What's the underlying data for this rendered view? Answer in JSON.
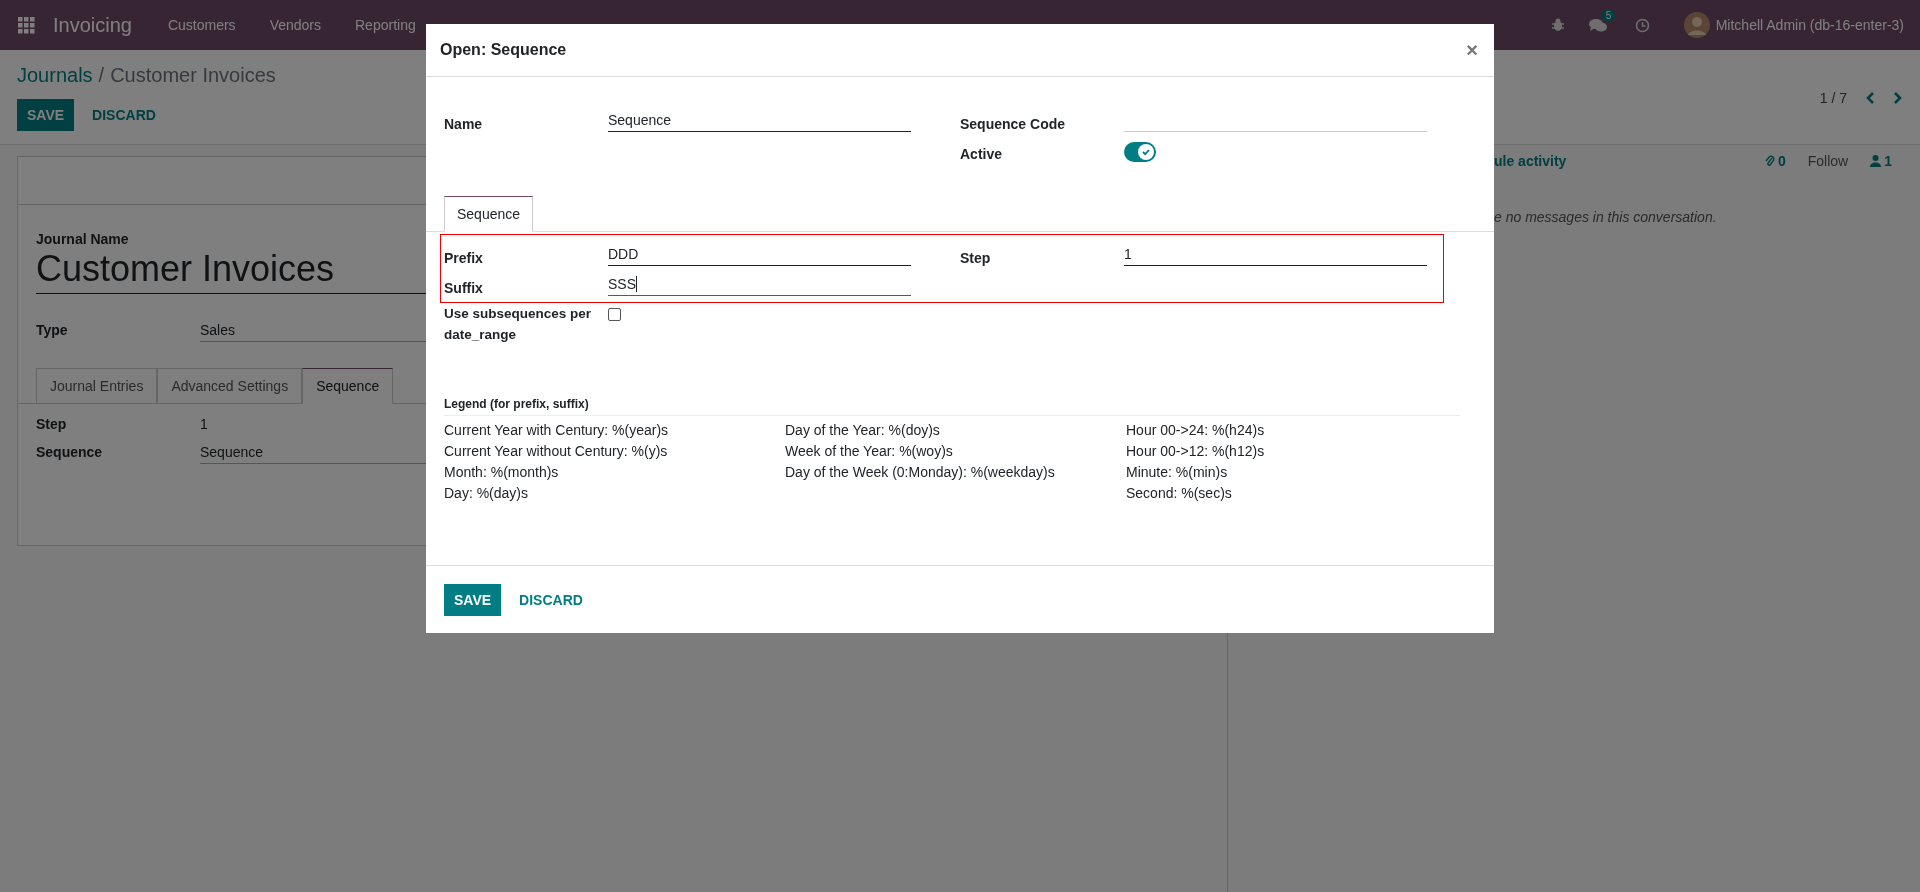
{
  "navbar": {
    "app": "Invoicing",
    "menus": [
      "Customers",
      "Vendors",
      "Reporting"
    ],
    "message_count": "5",
    "user": "Mitchell Admin (db-16-enter-3)"
  },
  "breadcrumb": [
    {
      "label": "Journals",
      "link": true
    },
    {
      "label": "/",
      "link": false
    },
    {
      "label": "Customer Invoices",
      "link": false
    }
  ],
  "form_buttons": [
    {
      "label": "SAVE",
      "kind": "primary"
    },
    {
      "label": "DISCARD",
      "kind": "link"
    }
  ],
  "pager": "1 / 7",
  "form": {
    "name_label": "Journal Name",
    "name": "Customer Invoices",
    "fields": [
      {
        "label": "Type",
        "value": "Sales"
      }
    ],
    "tabs": [
      {
        "label": "Journal Entries",
        "selected": false
      },
      {
        "label": "Advanced Settings",
        "selected": false
      },
      {
        "label": "Sequence",
        "selected": true
      }
    ],
    "tab_fields": [
      {
        "label": "Step",
        "value": "1",
        "underline": false
      },
      {
        "label": "Sequence",
        "value": "Sequence",
        "underline": true
      }
    ]
  },
  "chatter": {
    "schedule_activity": "ule activity",
    "attachments": "0",
    "follow": "Follow",
    "followers": "1",
    "empty_message": "e no messages in this conversation."
  },
  "dialog": {
    "title": "Open: Sequence",
    "close": "×",
    "name_field": {
      "label": "Name",
      "value": "Sequence"
    },
    "code_field": {
      "label": "Sequence Code"
    },
    "active": {
      "label": "Active",
      "on": true
    },
    "tabs": [
      {
        "label": "Sequence",
        "selected": true
      }
    ],
    "highlighted_fields": [
      {
        "label": "Prefix",
        "value": "DDD",
        "focused": false
      },
      {
        "label": "Step",
        "value": "1",
        "focused": false
      },
      {
        "label": "Suffix",
        "value": "SSS",
        "focused": true
      }
    ],
    "subsequences": {
      "label": "Use subsequences per date_range",
      "checked": false
    },
    "legend": {
      "title": "Legend (for prefix, suffix)",
      "columns": [
        [
          "Current Year with Century: %(year)s",
          "Current Year without Century: %(y)s",
          "Month: %(month)s",
          "Day: %(day)s"
        ],
        [
          "Day of the Year: %(doy)s",
          "Week of the Year: %(woy)s",
          "Day of the Week (0:Monday): %(weekday)s"
        ],
        [
          "Hour 00->24: %(h24)s",
          "Hour 00->12: %(h12)s",
          "Minute: %(min)s",
          "Second: %(sec)s"
        ]
      ]
    },
    "buttons": [
      {
        "label": "SAVE",
        "kind": "primary"
      },
      {
        "label": "DISCARD",
        "kind": "link"
      }
    ]
  }
}
